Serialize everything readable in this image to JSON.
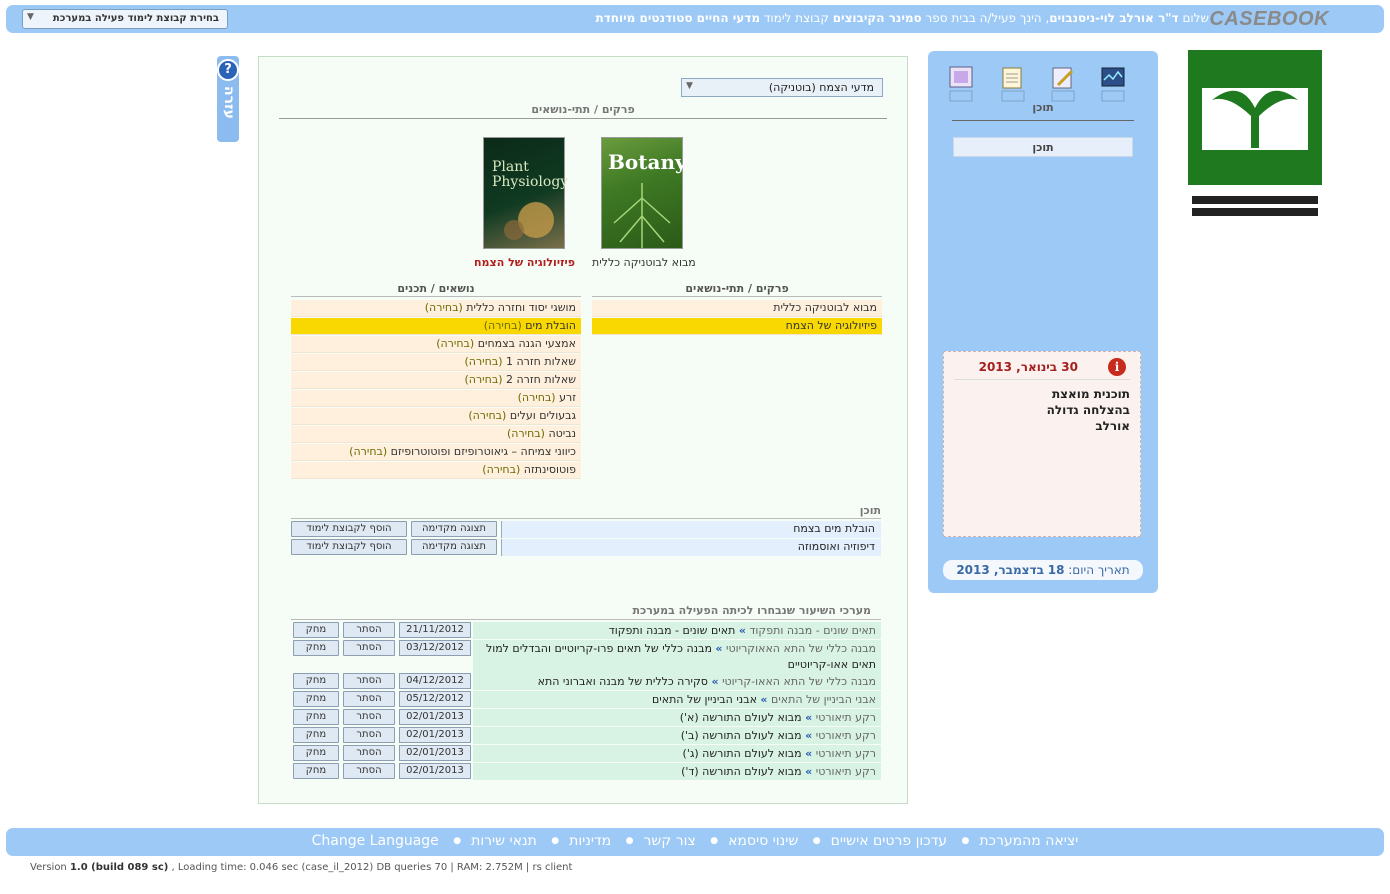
{
  "brand": "CASEBOOK",
  "greeting": {
    "hello": "שלום",
    "user": "ד\"ר אורלב לוי-ניסנבוים",
    "mid1": ", הינך פעיל/ה בבית ספר",
    "school": "סמינר הקיבוצים",
    "mid2": "קבוצת לימוד",
    "group": "מדעי החיים סטודנטים מיוחדת"
  },
  "group_select": {
    "label": "בחירת קבוצת לימוד פעילה במערכת"
  },
  "logo": {
    "alt_text": "סמינר הקיבוצים - המכללה לחינוך לטכנולוגיה ולאמנויות"
  },
  "nav": {
    "icons": [
      "computer-icon",
      "notepad-icon",
      "edit-icon",
      "chart-icon"
    ],
    "label": "תוכן",
    "tab": "תוכן"
  },
  "news": {
    "date_day": "30",
    "date_rest": "בינואר, 2013",
    "lines": [
      "תוכנית מואצת",
      "בהצלחה גדולה",
      "אורלב"
    ]
  },
  "today": {
    "label": "תאריך היום:",
    "day": "18",
    "month_year": "בדצמבר, 2013"
  },
  "help": {
    "label": "עזרה"
  },
  "main": {
    "subject_select": "מדעי הצמח (בוטניקה)",
    "chapters_heading": "פרקים / תתי-נושאים",
    "books": [
      {
        "title": "Botany",
        "caption": "מבוא לבוטניקה כללית"
      },
      {
        "title": "Plant Physiology",
        "caption": "פיזיולוגיה של הצמח"
      }
    ],
    "chapters_col_title": "פרקים / תתי-נושאים",
    "topics_col_title": "נושאים / תכנים",
    "chapters": [
      {
        "label": "מבוא לבוטניקה כללית",
        "selected": false
      },
      {
        "label": "פיזיולוגיה של הצמח",
        "selected": true
      }
    ],
    "select_word": "(בחירה)",
    "topics": [
      {
        "label": "מושגי יסוד וחזרה כללית",
        "selected": false
      },
      {
        "label": "הובלת מים",
        "selected": true
      },
      {
        "label": "אמצעי הגנה בצמחים",
        "selected": false
      },
      {
        "label": "שאלות חזרה 1",
        "selected": false
      },
      {
        "label": "שאלות חזרה 2",
        "selected": false
      },
      {
        "label": "זרע",
        "selected": false
      },
      {
        "label": "גבעולים ועלים",
        "selected": false
      },
      {
        "label": "נביטה",
        "selected": false
      },
      {
        "label": "כיווני צמיחה – גיאוטרופיזם ופוטוטרופיזם",
        "selected": false
      },
      {
        "label": "פוטוסינתזה",
        "selected": false
      }
    ],
    "content_title": "תוכן",
    "content_rows": [
      {
        "name": "הובלת מים בצמח",
        "preview": "תצוגה מקדימה",
        "add": "הוסף לקבוצת לימוד"
      },
      {
        "name": "דיפוזיה ואוסמוזה",
        "preview": "תצוגה מקדימה",
        "add": "הוסף לקבוצת לימוד"
      }
    ],
    "lessons_title": "מערכי השיעור שנבחרו לכיתה הפעילה במערכת",
    "hide_label": "הסתר",
    "delete_label": "מחק",
    "lessons": [
      {
        "category": "תאים שונים - מבנה ותפקוד",
        "lesson": "תאים שונים - מבנה ותפקוד",
        "date": "21/11/2012"
      },
      {
        "category": "מבנה כללי של התא האאוקריוטי",
        "lesson": "מבנה כללי של תאים פרו-קריוטיים והבדלים למול תאים אאו-קריוטיים",
        "date": "03/12/2012"
      },
      {
        "category": "מבנה כללי של התא האאו-קריוטי",
        "lesson": "סקירה כללית של מבנה ואברוני התא האאו-קריוטי",
        "date": "04/12/2012"
      },
      {
        "category": "אבני הביניין של התאים",
        "lesson": "אבני הביניין של התאים",
        "date": "05/12/2012"
      },
      {
        "category": "רקע תיאורטי",
        "lesson": "מבוא לעולם התורשה (א')",
        "date": "02/01/2013"
      },
      {
        "category": "רקע תיאורטי",
        "lesson": "מבוא לעולם התורשה (ב')",
        "date": "02/01/2013"
      },
      {
        "category": "רקע תיאורטי",
        "lesson": "מבוא לעולם התורשה (ג')",
        "date": "02/01/2013"
      },
      {
        "category": "רקע תיאורטי",
        "lesson": "מבוא לעולם התורשה (ד')",
        "date": "02/01/2013"
      }
    ]
  },
  "footer": {
    "links": [
      "יציאה מהמערכת",
      "עדכון פרטים אישיים",
      "שינוי סיסמא",
      "צור קשר",
      "מדיניות",
      "תנאי שירות",
      "Change Language"
    ]
  },
  "version": {
    "prefix": "Version",
    "build": "1.0 (build 089 sc)",
    "rest": ", Loading time: 0.046 sec  (case_il_2012) DB queries 70 | RAM: 2.752M | rs client"
  }
}
